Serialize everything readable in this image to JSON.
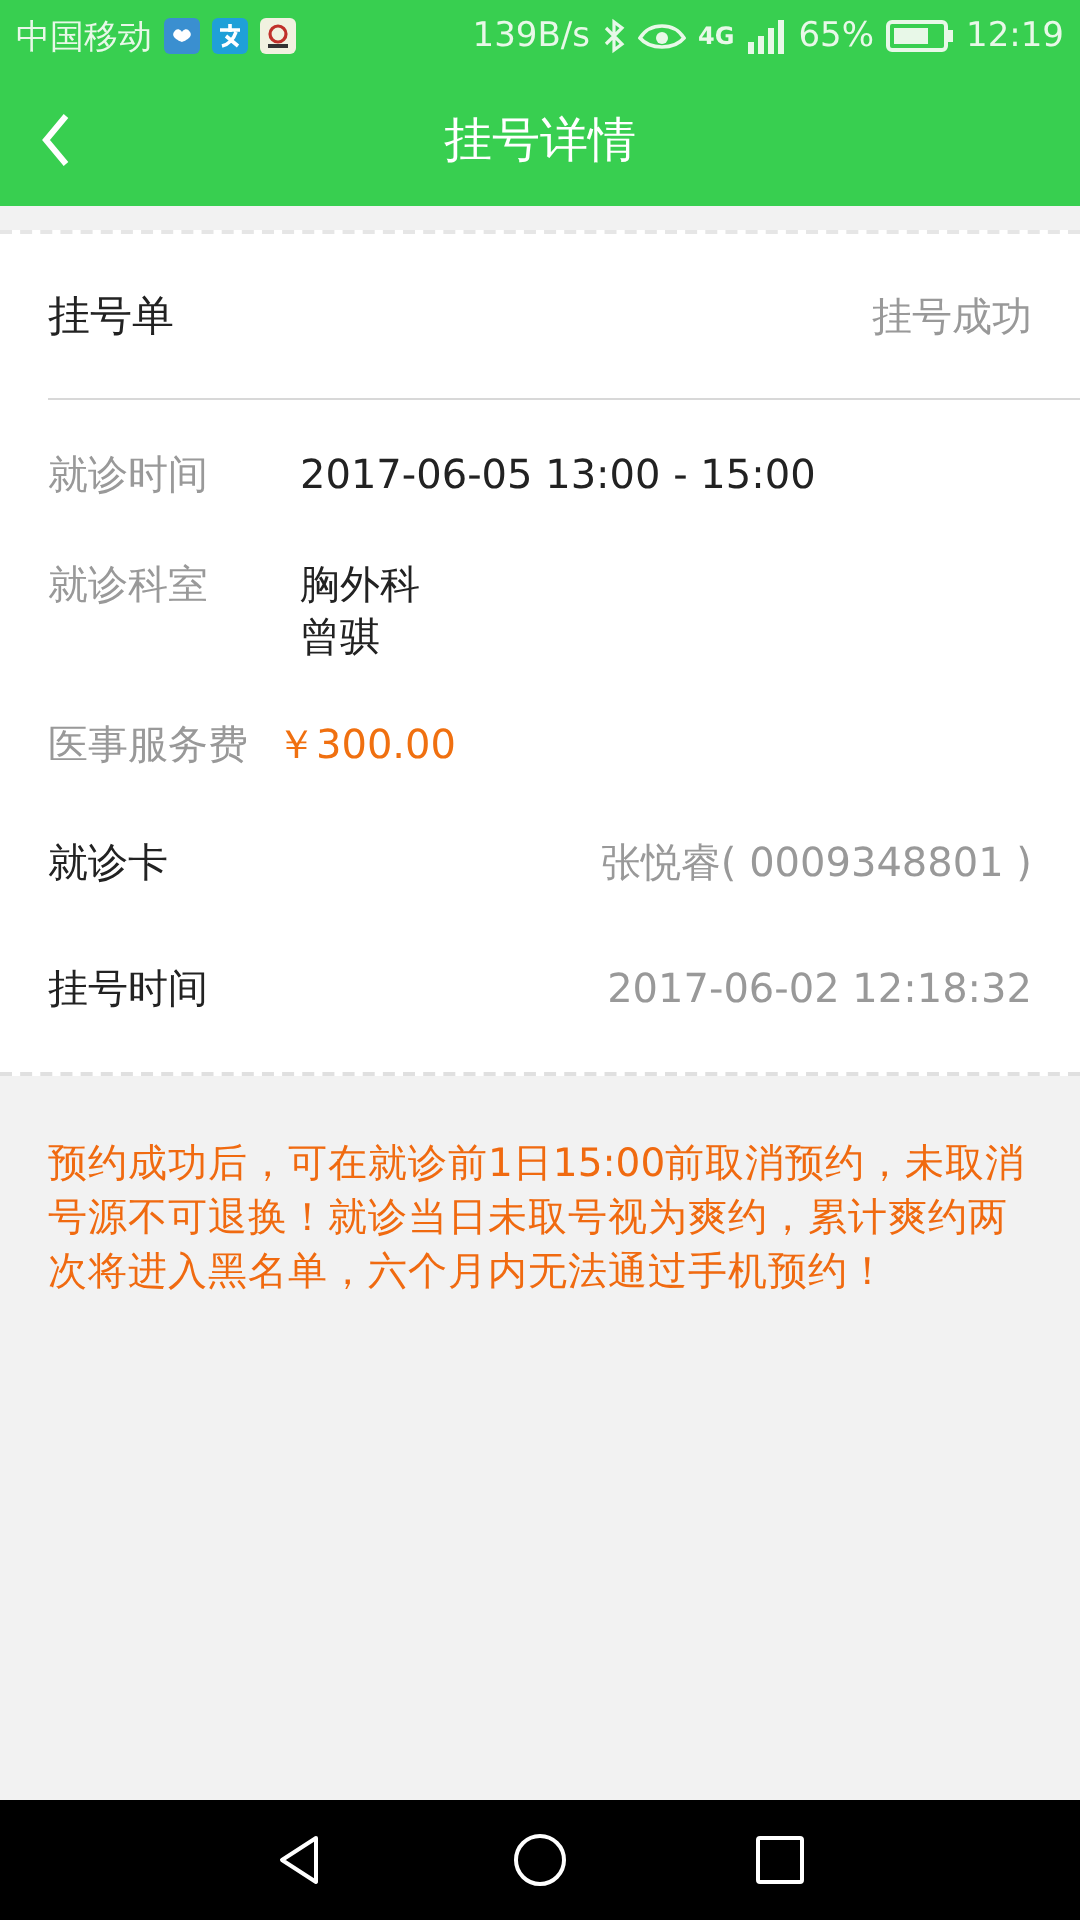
{
  "status_bar": {
    "carrier": "中国移动",
    "speed": "139B/s",
    "network": "4G",
    "battery": "65%",
    "time": "12:19"
  },
  "app_bar": {
    "title": "挂号详情"
  },
  "order": {
    "title": "挂号单",
    "status": "挂号成功"
  },
  "details": [
    {
      "kind": "detail",
      "label": "就诊时间",
      "lines": [
        "2017-06-05 13:00 - 15:00"
      ]
    },
    {
      "kind": "detail",
      "label": "就诊科室",
      "lines": [
        "胸外科",
        "曾骐"
      ]
    },
    {
      "kind": "price",
      "label": "医事服务费",
      "lines": [
        "￥300.00"
      ]
    },
    {
      "kind": "summary",
      "label": "就诊卡",
      "lines": [
        "张悦睿( 0009348801 )"
      ]
    },
    {
      "kind": "summary",
      "label": "挂号时间",
      "lines": [
        "2017-06-02 12:18:32"
      ]
    }
  ],
  "notice": "预约成功后，可在就诊前1日15:00前取消预约，未取消号源不可退换！就诊当日未取号视为爽约，累计爽约两次将进入黑名单，六个月内无法通过手机预约！"
}
